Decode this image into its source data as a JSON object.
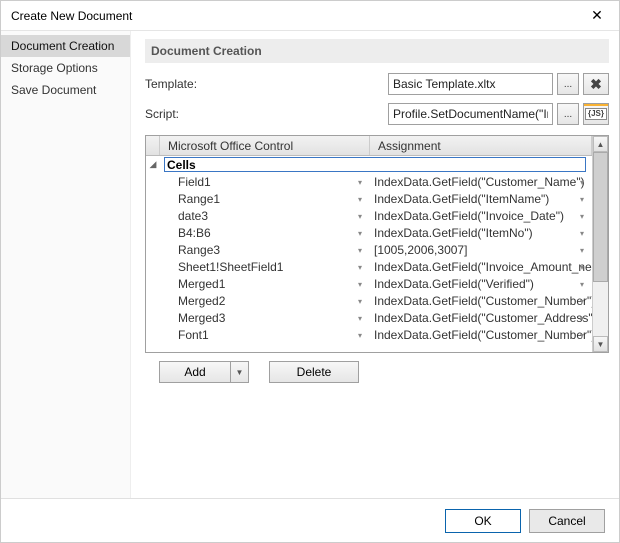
{
  "title": "Create New Document",
  "sidebar": {
    "items": [
      {
        "label": "Document Creation",
        "selected": true
      },
      {
        "label": "Storage Options",
        "selected": false
      },
      {
        "label": "Save Document",
        "selected": false
      }
    ]
  },
  "section": {
    "heading": "Document Creation",
    "template_label": "Template:",
    "template_value": "Basic Template.xltx",
    "script_label": "Script:",
    "script_value": "Profile.SetDocumentName(\"Invoice\" +"
  },
  "grid": {
    "columns": {
      "control": "Microsoft Office Control",
      "assignment": "Assignment"
    },
    "group": "Cells",
    "rows": [
      {
        "control": "Field1",
        "assignment": "IndexData.GetField(\"Customer_Name\")"
      },
      {
        "control": "Range1",
        "assignment": "IndexData.GetField(\"ItemName\")"
      },
      {
        "control": "date3",
        "assignment": "IndexData.GetField(\"Invoice_Date\")"
      },
      {
        "control": "B4:B6",
        "assignment": "IndexData.GetField(\"ItemNo\")"
      },
      {
        "control": "Range3",
        "assignment": "[1005,2006,3007]"
      },
      {
        "control": "Sheet1!SheetField1",
        "assignment": "IndexData.GetField(\"Invoice_Amount_ne"
      },
      {
        "control": "Merged1",
        "assignment": "IndexData.GetField(\"Verified\")"
      },
      {
        "control": "Merged2",
        "assignment": "IndexData.GetField(\"Customer_Number\")"
      },
      {
        "control": "Merged3",
        "assignment": "IndexData.GetField(\"Customer_Address\","
      },
      {
        "control": "Font1",
        "assignment": "IndexData.GetField(\"Customer_Number\")"
      }
    ]
  },
  "buttons": {
    "add": "Add",
    "delete": "Delete",
    "ok": "OK",
    "cancel": "Cancel",
    "browse": "...",
    "script_more": "..."
  }
}
